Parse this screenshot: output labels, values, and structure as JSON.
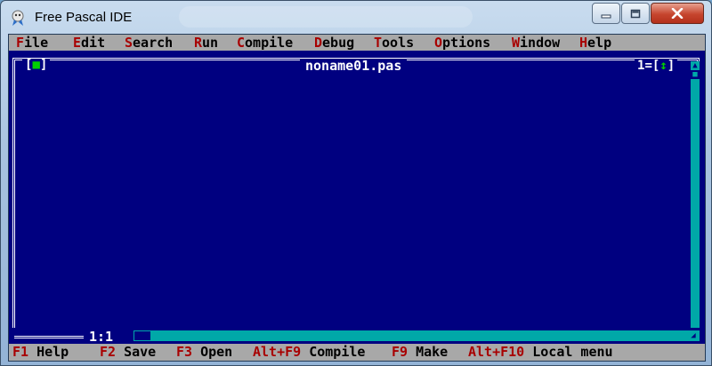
{
  "window": {
    "title": "Free Pascal IDE",
    "controls": {
      "minimize": "minimize-icon",
      "maximize": "maximize-icon",
      "close": "close-icon"
    }
  },
  "menu": [
    {
      "label": "File",
      "hotkey": "F",
      "rest": "ile"
    },
    {
      "label": "Edit",
      "hotkey": "E",
      "rest": "dit"
    },
    {
      "label": "Search",
      "hotkey": "S",
      "rest": "earch"
    },
    {
      "label": "Run",
      "hotkey": "R",
      "rest": "un"
    },
    {
      "label": "Compile",
      "hotkey": "C",
      "rest": "ompile"
    },
    {
      "label": "Debug",
      "hotkey": "D",
      "rest": "ebug"
    },
    {
      "label": "Tools",
      "hotkey": "T",
      "rest": "ools"
    },
    {
      "label": "Options",
      "hotkey": "O",
      "rest": "ptions"
    },
    {
      "label": "Window",
      "hotkey": "W",
      "rest": "indow"
    },
    {
      "label": "Help",
      "hotkey": "H",
      "rest": "elp"
    }
  ],
  "editor": {
    "filename": "noname01.pas",
    "close_box": {
      "open": "[",
      "mark": "■",
      "close": "]"
    },
    "window_number": "1",
    "zoom_box": {
      "open": "=[",
      "mark": "↕",
      "close": "]"
    },
    "cursor_position": "1:1"
  },
  "status": [
    {
      "key": "F1",
      "label": " Help"
    },
    {
      "key": "F2",
      "label": " Save"
    },
    {
      "key": "F3",
      "label": " Open"
    },
    {
      "key": "Alt+F9",
      "label": " Compile"
    },
    {
      "key": "F9",
      "label": " Make"
    },
    {
      "key": "Alt+F10",
      "label": " Local menu"
    }
  ],
  "colors": {
    "editor_bg": "#000080",
    "menu_bg": "#a8a8a8",
    "hotkey": "#a80000",
    "scrollbar": "#00a8a8",
    "frame_marker": "#00d000"
  }
}
